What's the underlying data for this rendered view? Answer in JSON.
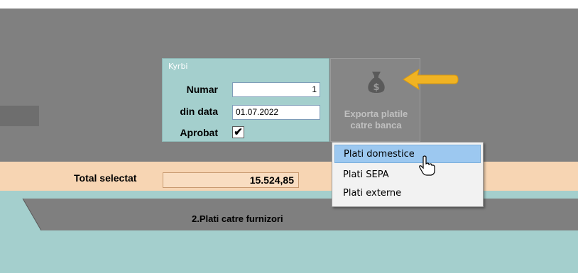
{
  "filter_panel": {
    "title": "Kyrbi",
    "numar_label": "Numar",
    "numar_value": "1",
    "din_data_label": "din data",
    "din_data_value": "01.07.2022",
    "aprobat_label": "Aprobat",
    "aprobat_checked": "✔"
  },
  "export_button": {
    "line1": "Exporta platile",
    "line2": "catre banca",
    "icon": "money-bag-icon"
  },
  "context_menu": {
    "items": [
      {
        "label": "Plati domestice"
      },
      {
        "label": "Plati SEPA"
      },
      {
        "label": "Plati externe"
      }
    ]
  },
  "totals": {
    "label": "Total selectat",
    "value": "15.524,85"
  },
  "tabs": {
    "active_label": "2.Plati catre furnizori"
  },
  "colors": {
    "panel_teal": "#a4cfcd",
    "total_bar": "#f7d5b3",
    "arrow": "#f0b323",
    "menu_highlight": "#9cc8f0"
  }
}
